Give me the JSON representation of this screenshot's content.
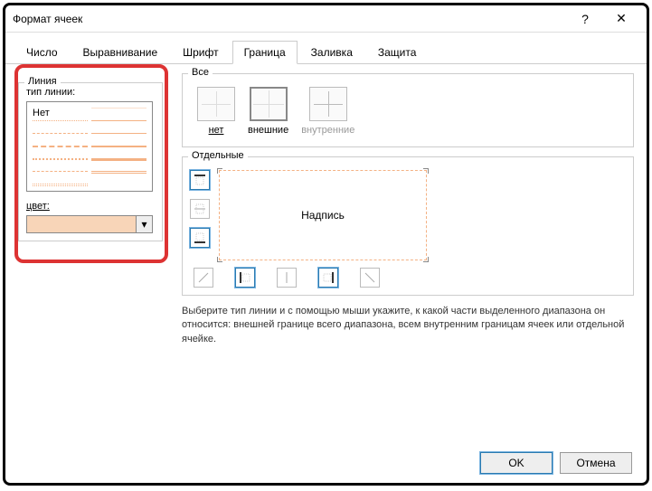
{
  "title": "Формат ячеек",
  "tabs": [
    "Число",
    "Выравнивание",
    "Шрифт",
    "Граница",
    "Заливка",
    "Защита"
  ],
  "line": {
    "group": "Линия",
    "typeLabel": "тип линии:",
    "none": "Нет",
    "colorLabel": "цвет:"
  },
  "all": {
    "group": "Все",
    "presets": {
      "none": "нет",
      "outer": "внешние",
      "inner": "внутренние"
    }
  },
  "individual": {
    "group": "Отдельные",
    "previewText": "Надпись"
  },
  "hint": "Выберите тип линии и с помощью мыши укажите, к какой части выделенного диапазона он относится: внешней границе всего диапазона, всем внутренним границам ячеек или отдельной ячейке.",
  "buttons": {
    "ok": "OK",
    "cancel": "Отмена"
  }
}
